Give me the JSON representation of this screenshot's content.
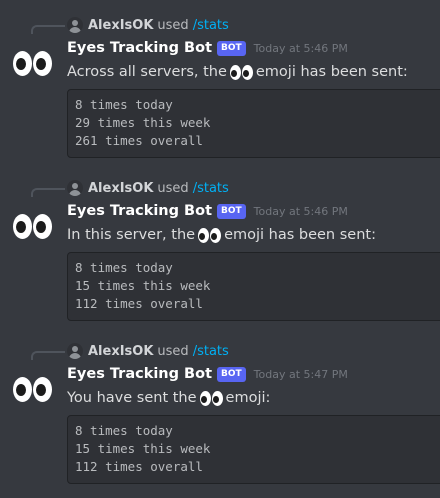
{
  "messages": [
    {
      "reply_user": "AlexIsOK",
      "reply_used": "used",
      "reply_command": "/stats",
      "bot_name": "Eyes Tracking Bot",
      "bot_tag": "BOT",
      "timestamp": "Today at 5:46 PM",
      "text_before": "Across all servers, the",
      "text_after": "emoji has been sent:",
      "stats": [
        "8 times today",
        "29 times this week",
        "261 times overall"
      ]
    },
    {
      "reply_user": "AlexIsOK",
      "reply_used": "used",
      "reply_command": "/stats",
      "bot_name": "Eyes Tracking Bot",
      "bot_tag": "BOT",
      "timestamp": "Today at 5:46 PM",
      "text_before": "In this server, the",
      "text_after": "emoji has been sent:",
      "stats": [
        "8 times today",
        "15 times this week",
        "112 times overall"
      ]
    },
    {
      "reply_user": "AlexIsOK",
      "reply_used": "used",
      "reply_command": "/stats",
      "bot_name": "Eyes Tracking Bot",
      "bot_tag": "BOT",
      "timestamp": "Today at 5:47 PM",
      "text_before": "You have sent the",
      "text_after": "emoji:",
      "stats": [
        "8 times today",
        "15 times this week",
        "112 times overall"
      ]
    }
  ],
  "icons": {
    "bot_avatar": "eyes-emoji-icon",
    "reply_avatar": "default-user-avatar-icon",
    "inline_emoji": "eyes-emoji-icon"
  },
  "colors": {
    "background": "#36393f",
    "bot_tag": "#5865f2",
    "command": "#00b0f4",
    "codeblock": "#2f3136"
  }
}
